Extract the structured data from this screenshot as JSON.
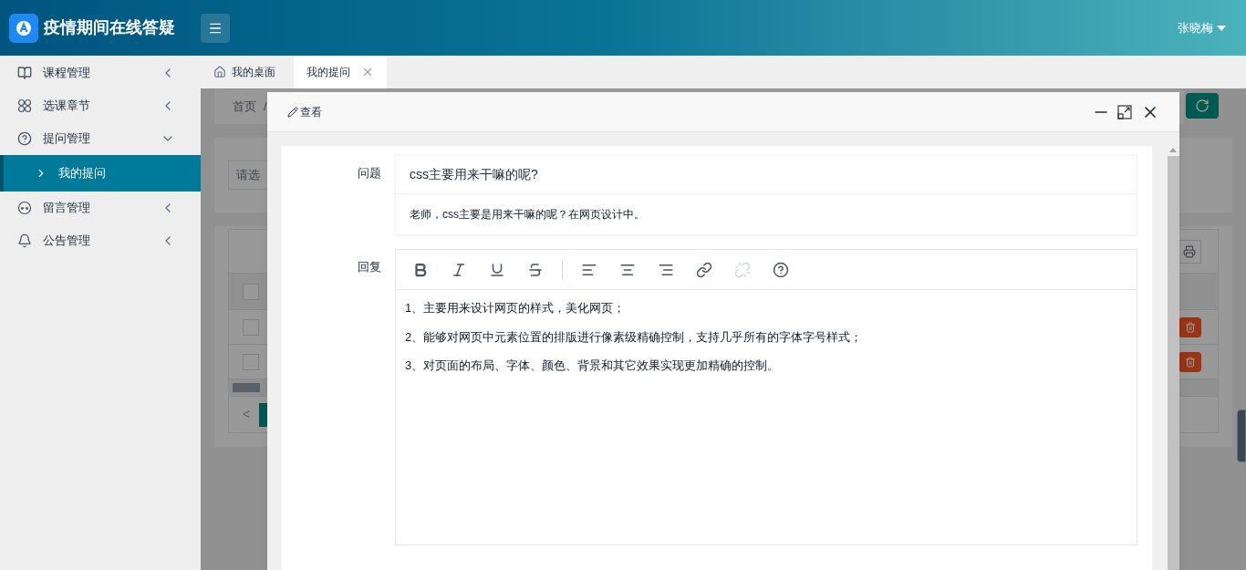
{
  "header": {
    "title": "疫情期间在线答疑",
    "user": "张晓梅"
  },
  "sidebar": {
    "items": [
      {
        "label": "课程管理",
        "expanded": false
      },
      {
        "label": "选课章节",
        "expanded": false
      },
      {
        "label": "提问管理",
        "expanded": true,
        "children": [
          {
            "label": "我的提问",
            "selected": true
          }
        ]
      },
      {
        "label": "留言管理",
        "expanded": false
      },
      {
        "label": "公告管理",
        "expanded": false
      }
    ]
  },
  "tabs": [
    {
      "label": "我的桌面",
      "kind": "home",
      "selected": false
    },
    {
      "label": "我的提问",
      "kind": "closable",
      "selected": true
    }
  ],
  "page": {
    "breadcrumb": [
      "首页",
      "/"
    ],
    "filter": {
      "placeholder": "请选"
    },
    "table": {
      "header_checked": false,
      "rows": [
        {
          "checked": false
        },
        {
          "checked": false
        }
      ],
      "pager": "<"
    }
  },
  "modal": {
    "title": "查看",
    "question_label": "问题",
    "question_title": "css主要用来干嘛的呢?",
    "question_body": "老师，css主要是用来干嘛的呢？在网页设计中。",
    "reply_label": "回复",
    "toolbar": [
      {
        "kind": "bold",
        "disabled": false
      },
      {
        "kind": "italic",
        "disabled": false
      },
      {
        "kind": "underline",
        "disabled": false
      },
      {
        "kind": "strike",
        "disabled": false
      },
      {
        "kind": "separator"
      },
      {
        "kind": "align-left",
        "disabled": false
      },
      {
        "kind": "align-center",
        "disabled": false
      },
      {
        "kind": "align-right",
        "disabled": false
      },
      {
        "kind": "link",
        "disabled": false
      },
      {
        "kind": "unlink",
        "disabled": true
      },
      {
        "kind": "help",
        "disabled": false
      }
    ],
    "reply_paragraphs": [
      "1、主要用来设计网页的样式，美化网页；",
      "2、能够对网页中元素位置的排版进行像素级精确控制，支持几乎所有的字体字号样式；",
      "3、对页面的布局、字体、颜色、背景和其它效果实现更加精确的控制。"
    ]
  }
}
